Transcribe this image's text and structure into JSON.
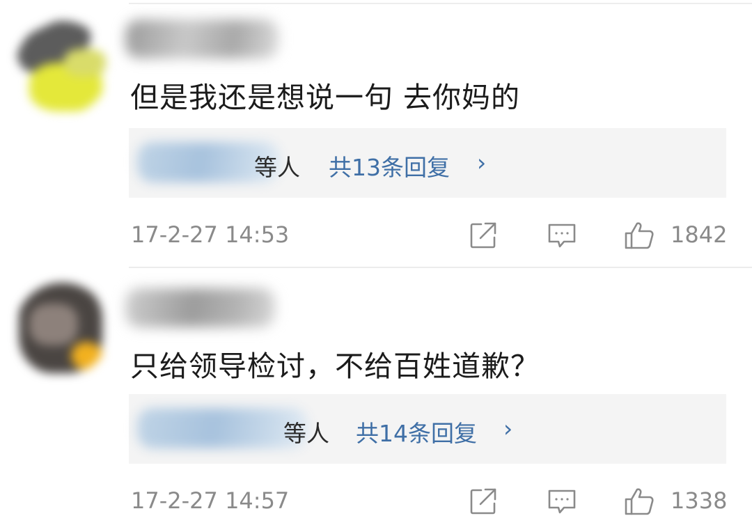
{
  "comments": [
    {
      "text": "但是我还是想说一句 去你妈的",
      "replies_suffix": "等人",
      "reply_count_label": "共13条回复",
      "chevron": "›",
      "timestamp": "17-2-27 14:53",
      "like_count": "1842",
      "avatar_colors": [
        "#5a5a5a",
        "#e6ea3c",
        "#d8dc52"
      ]
    },
    {
      "text": "只给领导检讨，不给百姓道歉？",
      "replies_suffix": "等人",
      "reply_count_label": "共14条回复",
      "chevron": "›",
      "timestamp": "17-2-27 14:57",
      "like_count": "1338",
      "avatar_colors": [
        "#3e3a38",
        "#8a7d76",
        "#f0b020"
      ]
    }
  ],
  "icons": {
    "share": "share-icon",
    "comment": "comment-icon",
    "like": "like-icon"
  },
  "colors": {
    "link": "#3f6fa6",
    "meta": "#8a8a8a",
    "reply_box": "#f4f4f4"
  }
}
